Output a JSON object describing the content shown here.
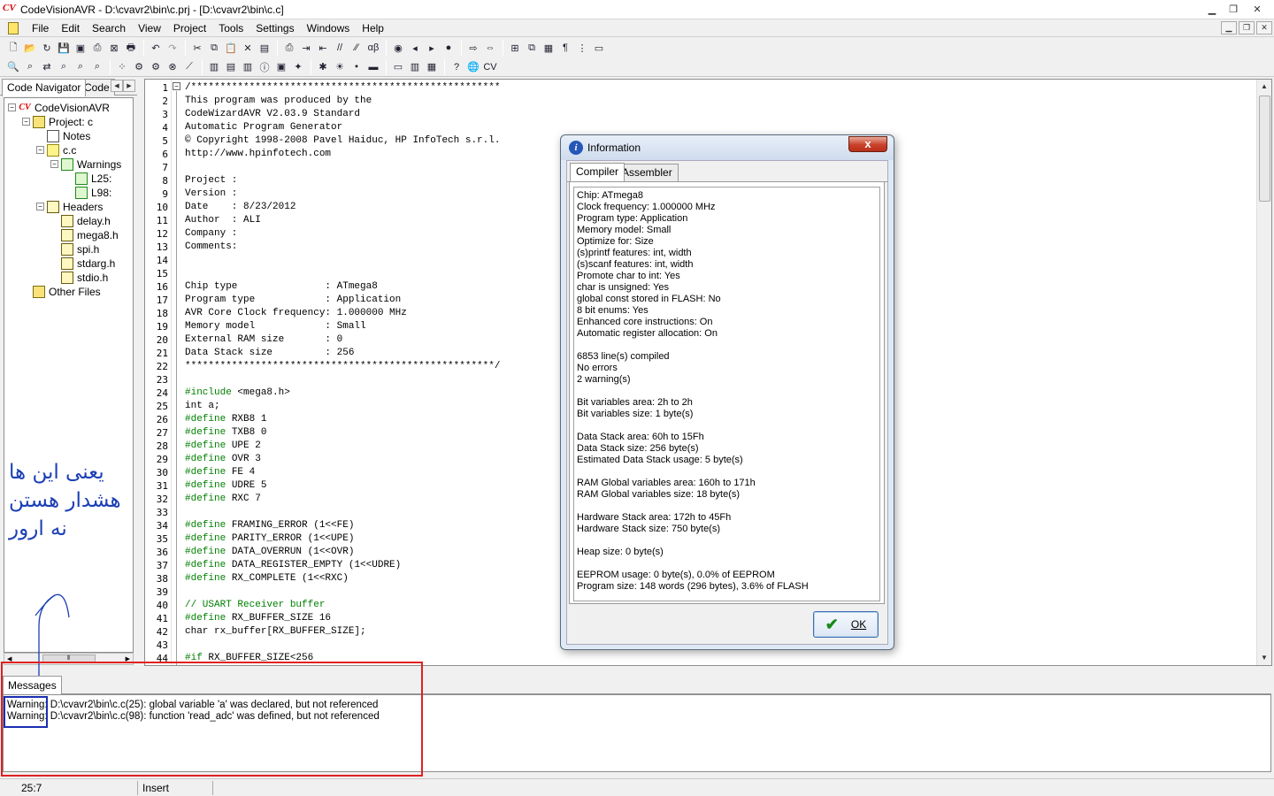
{
  "window": {
    "title": "CodeVisionAVR - D:\\cvavr2\\bin\\c.prj - [D:\\cvavr2\\bin\\c.c]",
    "app_icon": "CV"
  },
  "menu": [
    "File",
    "Edit",
    "Search",
    "View",
    "Project",
    "Tools",
    "Settings",
    "Windows",
    "Help"
  ],
  "toolbar1": [
    {
      "name": "new-file-icon",
      "glyph": "🗋"
    },
    {
      "name": "open-file-icon",
      "glyph": "📂"
    },
    {
      "name": "reload-icon",
      "glyph": "↻"
    },
    {
      "name": "save-icon",
      "glyph": "💾"
    },
    {
      "name": "save-all-icon",
      "glyph": "▣"
    },
    {
      "name": "print-preview-icon",
      "glyph": "⎙"
    },
    {
      "name": "close-icon",
      "glyph": "⊠"
    },
    {
      "name": "print-icon",
      "glyph": "🖶"
    },
    {
      "sep": true
    },
    {
      "name": "undo-icon",
      "glyph": "↶"
    },
    {
      "name": "redo-icon",
      "glyph": "↷",
      "dim": true
    },
    {
      "sep": true
    },
    {
      "name": "cut-icon",
      "glyph": "✂"
    },
    {
      "name": "copy-icon",
      "glyph": "⧉"
    },
    {
      "name": "paste-icon",
      "glyph": "📋"
    },
    {
      "name": "delete-icon",
      "glyph": "✕"
    },
    {
      "name": "document-icon",
      "glyph": "▤"
    },
    {
      "sep": true
    },
    {
      "name": "print-selection-icon",
      "glyph": "⎙"
    },
    {
      "name": "indent-icon",
      "glyph": "⇥"
    },
    {
      "name": "unindent-icon",
      "glyph": "⇤"
    },
    {
      "name": "comment-icon",
      "glyph": "//"
    },
    {
      "name": "uncomment-icon",
      "glyph": "⁄⁄"
    },
    {
      "name": "match-brace-icon",
      "glyph": "αβ"
    },
    {
      "sep": true
    },
    {
      "name": "toggle-bookmark-icon",
      "glyph": "◉"
    },
    {
      "name": "bookmark-back-icon",
      "glyph": "◂"
    },
    {
      "name": "bookmark-next-icon",
      "glyph": "▸"
    },
    {
      "name": "bookmark-clear-icon",
      "glyph": "●"
    },
    {
      "sep": true
    },
    {
      "name": "goto-line-icon",
      "glyph": "⇨"
    },
    {
      "name": "jump-icon",
      "glyph": "⇔"
    },
    {
      "sep": true
    },
    {
      "name": "tile-icon",
      "glyph": "⊞"
    },
    {
      "name": "cascade-icon",
      "glyph": "⧉"
    },
    {
      "name": "arrange-icon",
      "glyph": "▦"
    },
    {
      "name": "paragraph-icon",
      "glyph": "¶"
    },
    {
      "name": "tree-icon",
      "glyph": "⋮"
    },
    {
      "name": "panel-icon",
      "glyph": "▭"
    }
  ],
  "toolbar2": [
    {
      "name": "find-icon",
      "glyph": "🔍"
    },
    {
      "name": "find-next-icon",
      "glyph": "⌕"
    },
    {
      "name": "replace-icon",
      "glyph": "⇄"
    },
    {
      "name": "find-in-files-icon",
      "glyph": "⌕"
    },
    {
      "name": "search-project-icon",
      "glyph": "⌕"
    },
    {
      "name": "search-replace-icon",
      "glyph": "⌕"
    },
    {
      "sep": true
    },
    {
      "name": "check-syntax-icon",
      "glyph": "⁘"
    },
    {
      "name": "compile-icon",
      "glyph": "⚙"
    },
    {
      "name": "make-icon",
      "glyph": "⚙"
    },
    {
      "name": "stop-icon",
      "glyph": "⊗"
    },
    {
      "name": "wand-icon",
      "glyph": "⟋"
    },
    {
      "sep": true
    },
    {
      "name": "project-icon",
      "glyph": "▥"
    },
    {
      "name": "notes-icon",
      "glyph": "▤"
    },
    {
      "name": "configure-icon",
      "glyph": "▥"
    },
    {
      "name": "info-icon",
      "glyph": "ⓘ"
    },
    {
      "name": "explore-icon",
      "glyph": "▣"
    },
    {
      "name": "codewizard-icon",
      "glyph": "✦"
    },
    {
      "sep": true
    },
    {
      "name": "debugger-icon",
      "glyph": "✱"
    },
    {
      "name": "bug-icon",
      "glyph": "☀"
    },
    {
      "name": "programmer-icon",
      "glyph": "⬩"
    },
    {
      "name": "chip-icon",
      "glyph": "▬"
    },
    {
      "sep": true
    },
    {
      "name": "terminal-icon",
      "glyph": "▭"
    },
    {
      "name": "lcd-icon",
      "glyph": "▥"
    },
    {
      "name": "calculator-icon",
      "glyph": "▦"
    },
    {
      "sep": true
    },
    {
      "name": "help-icon",
      "glyph": "?"
    },
    {
      "name": "web-icon",
      "glyph": "🌐"
    },
    {
      "name": "about-icon",
      "glyph": "CV"
    }
  ],
  "nav": {
    "tabs": [
      "Code Navigator",
      "Code"
    ],
    "tree": [
      {
        "label": "CodeVisionAVR",
        "icon": "cv",
        "indent": 0,
        "box": "−"
      },
      {
        "label": "Project: c",
        "icon": "proj",
        "indent": 1,
        "box": "−"
      },
      {
        "label": "Notes",
        "icon": "note",
        "indent": 2,
        "box": ""
      },
      {
        "label": "c.c",
        "icon": "cfile",
        "indent": 2,
        "box": "−"
      },
      {
        "label": "Warnings",
        "icon": "warn",
        "indent": 3,
        "box": "−"
      },
      {
        "label": "L25:",
        "icon": "warn",
        "indent": 4,
        "box": ""
      },
      {
        "label": "L98:",
        "icon": "warn",
        "indent": 4,
        "box": ""
      },
      {
        "label": "Headers",
        "icon": "hdr",
        "indent": 2,
        "box": "−"
      },
      {
        "label": "delay.h",
        "icon": "hdr",
        "indent": 3,
        "box": ""
      },
      {
        "label": "mega8.h",
        "icon": "hdr",
        "indent": 3,
        "box": ""
      },
      {
        "label": "spi.h",
        "icon": "hdr",
        "indent": 3,
        "box": ""
      },
      {
        "label": "stdarg.h",
        "icon": "hdr",
        "indent": 3,
        "box": ""
      },
      {
        "label": "stdio.h",
        "icon": "hdr",
        "indent": 3,
        "box": ""
      },
      {
        "label": "Other Files",
        "icon": "proj",
        "indent": 1,
        "box": ""
      }
    ]
  },
  "annotation": {
    "lines": [
      "یعنی این ها",
      "هشدار هستن",
      "نه ارور"
    ],
    "color": "#1b3fb4"
  },
  "editor": {
    "lines": [
      {
        "t": "/*****************************************************",
        "c": "cm"
      },
      {
        "t": "This program was produced by the",
        "c": ""
      },
      {
        "t": "CodeWizardAVR V2.03.9 Standard",
        "c": ""
      },
      {
        "t": "Automatic Program Generator",
        "c": ""
      },
      {
        "t": "© Copyright 1998-2008 Pavel Haiduc, HP InfoTech s.r.l.",
        "c": ""
      },
      {
        "t": "http://www.hpinfotech.com",
        "c": ""
      },
      {
        "t": "",
        "c": ""
      },
      {
        "t": "Project : ",
        "c": ""
      },
      {
        "t": "Version : ",
        "c": ""
      },
      {
        "t": "Date    : 8/23/2012",
        "c": ""
      },
      {
        "t": "Author  : ALI",
        "c": ""
      },
      {
        "t": "Company : ",
        "c": ""
      },
      {
        "t": "Comments: ",
        "c": ""
      },
      {
        "t": "",
        "c": ""
      },
      {
        "t": "",
        "c": ""
      },
      {
        "t": "Chip type               : ATmega8",
        "c": ""
      },
      {
        "t": "Program type            : Application",
        "c": ""
      },
      {
        "t": "AVR Core Clock frequency: 1.000000 MHz",
        "c": ""
      },
      {
        "t": "Memory model            : Small",
        "c": ""
      },
      {
        "t": "External RAM size       : 0",
        "c": ""
      },
      {
        "t": "Data Stack size         : 256",
        "c": ""
      },
      {
        "t": "*****************************************************/",
        "c": ""
      },
      {
        "t": "",
        "c": ""
      },
      {
        "t": "#include <mega8.h>",
        "c": "pp",
        "kw": "#include"
      },
      {
        "t": "int a;",
        "c": ""
      },
      {
        "t": "#define RXB8 1",
        "c": "pp",
        "kw": "#define"
      },
      {
        "t": "#define TXB8 0",
        "c": "pp",
        "kw": "#define"
      },
      {
        "t": "#define UPE 2",
        "c": "pp",
        "kw": "#define"
      },
      {
        "t": "#define OVR 3",
        "c": "pp",
        "kw": "#define"
      },
      {
        "t": "#define FE 4",
        "c": "pp",
        "kw": "#define"
      },
      {
        "t": "#define UDRE 5",
        "c": "pp",
        "kw": "#define"
      },
      {
        "t": "#define RXC 7",
        "c": "pp",
        "kw": "#define"
      },
      {
        "t": "",
        "c": ""
      },
      {
        "t": "#define FRAMING_ERROR (1<<FE)",
        "c": "pp",
        "kw": "#define"
      },
      {
        "t": "#define PARITY_ERROR (1<<UPE)",
        "c": "pp",
        "kw": "#define"
      },
      {
        "t": "#define DATA_OVERRUN (1<<OVR)",
        "c": "pp",
        "kw": "#define"
      },
      {
        "t": "#define DATA_REGISTER_EMPTY (1<<UDRE)",
        "c": "pp",
        "kw": "#define"
      },
      {
        "t": "#define RX_COMPLETE (1<<RXC)",
        "c": "pp",
        "kw": "#define"
      },
      {
        "t": "",
        "c": ""
      },
      {
        "t": "// USART Receiver buffer",
        "c": "cm"
      },
      {
        "t": "#define RX_BUFFER_SIZE 16",
        "c": "pp",
        "kw": "#define"
      },
      {
        "t": "char rx_buffer[RX_BUFFER_SIZE];",
        "c": ""
      },
      {
        "t": "",
        "c": ""
      },
      {
        "t": "#if RX_BUFFER_SIZE<256",
        "c": "pp",
        "kw": "#if"
      }
    ]
  },
  "messages": {
    "tab": "Messages",
    "items": [
      {
        "prefix": "Warning:",
        "text": " D:\\cvavr2\\bin\\c.c(25): global variable 'a' was declared, but not referenced"
      },
      {
        "prefix": "Warning:",
        "text": " D:\\cvavr2\\bin\\c.c(98): function 'read_adc' was defined, but not referenced"
      }
    ]
  },
  "status": {
    "position": "25:7",
    "mode": "Insert"
  },
  "dialog": {
    "title": "Information",
    "close_label": "x",
    "tabs": [
      "Compiler",
      "Assembler"
    ],
    "lines": [
      "Chip: ATmega8",
      "Clock frequency: 1.000000 MHz",
      "Program type: Application",
      "Memory model: Small",
      "Optimize for: Size",
      "(s)printf features: int, width",
      "(s)scanf features: int, width",
      "Promote char to int: Yes",
      "char is unsigned: Yes",
      "global const stored in FLASH: No",
      "8 bit enums: Yes",
      "Enhanced core instructions: On",
      "Automatic register allocation: On",
      "",
      "6853 line(s) compiled",
      "No errors",
      "2 warning(s)",
      "",
      "Bit variables area: 2h to 2h",
      "Bit variables size: 1 byte(s)",
      "",
      "Data Stack area: 60h to 15Fh",
      "Data Stack size: 256 byte(s)",
      "Estimated Data Stack usage: 5 byte(s)",
      "",
      "RAM Global variables area: 160h to 171h",
      "RAM Global variables size: 18 byte(s)",
      "",
      "Hardware Stack area: 172h to 45Fh",
      "Hardware Stack size: 750 byte(s)",
      "",
      "Heap size: 0 byte(s)",
      "",
      "EEPROM usage: 0 byte(s), 0.0% of EEPROM",
      "Program size: 148 words (296 bytes), 3.6% of FLASH"
    ],
    "ok_label": "OK"
  }
}
